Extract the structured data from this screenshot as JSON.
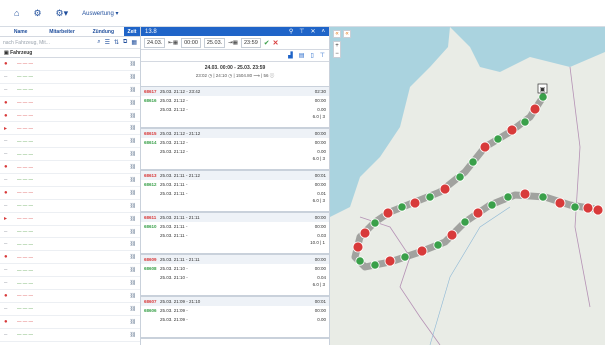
{
  "topbar": {
    "breadcrumb": "Auswertung ▾"
  },
  "left": {
    "tabs": [
      "Name",
      "Mitarbeiter",
      "Zündung",
      "Zeit"
    ],
    "filter_placeholder": "nach Fahrzeug, Mit...",
    "header": "Fahrzeug",
    "vehicles": [
      {
        "dot": "red",
        "status": "●",
        "name": "— — —"
      },
      {
        "dot": "gray",
        "status": "–",
        "name": "— — —"
      },
      {
        "dot": "gray",
        "status": "–",
        "name": "— — —"
      },
      {
        "dot": "red",
        "status": "●",
        "name": "— — —"
      },
      {
        "dot": "red",
        "status": "●",
        "name": "— — —"
      },
      {
        "dot": "red",
        "status": "▸",
        "name": "— — —"
      },
      {
        "dot": "gray",
        "status": "–",
        "name": "— — —"
      },
      {
        "dot": "gray",
        "status": "–",
        "name": "— — —"
      },
      {
        "dot": "red",
        "status": "●",
        "name": "— — —"
      },
      {
        "dot": "gray",
        "status": "–",
        "name": "— — —"
      },
      {
        "dot": "red",
        "status": "●",
        "name": "— — —"
      },
      {
        "dot": "gray",
        "status": "–",
        "name": "— — —"
      },
      {
        "dot": "red",
        "status": "▸",
        "name": "— — —"
      },
      {
        "dot": "gray",
        "status": "–",
        "name": "— — —"
      },
      {
        "dot": "gray",
        "status": "–",
        "name": "— — —"
      },
      {
        "dot": "red",
        "status": "●",
        "name": "— — —"
      },
      {
        "dot": "gray",
        "status": "–",
        "name": "— — —"
      },
      {
        "dot": "gray",
        "status": "–",
        "name": "— — —"
      },
      {
        "dot": "red",
        "status": "●",
        "name": "— — —"
      },
      {
        "dot": "gray",
        "status": "–",
        "name": "— — —"
      },
      {
        "dot": "red",
        "status": "●",
        "name": "— — —"
      },
      {
        "dot": "gray",
        "status": "–",
        "name": "— — —"
      }
    ]
  },
  "mid": {
    "title": "13.8",
    "date_from": "24.03.",
    "time_from": "00:00",
    "date_to": "25.03.",
    "time_to": "23:59",
    "summary_range": "24.03. 00:00 - 25.03. 23:59",
    "summary_stats": "23:02 ◷ | 24:10 ◷ | 1504.80 ⟶ | 56 ⓘ",
    "trips": [
      {
        "id": "68617",
        "line1": "25.03. 21:12 - 23:42",
        "v1": "02:30",
        "id2": "68616",
        "line2": "25.03. 21:12 - ",
        "v2": "00:00",
        "line3": "25.03. 21:12 - ",
        "v3": "0.00",
        "foot": "6.0 | 3"
      },
      {
        "id": "68615",
        "line1": "25.03. 21:12 - 21:12",
        "v1": "00:00",
        "id2": "68614",
        "line2": "25.03. 21:12 - ",
        "v2": "00:00",
        "line3": "25.03. 21:12 - ",
        "v3": "0.00",
        "foot": "6.0 | 3"
      },
      {
        "id": "68613",
        "line1": "25.03. 21:11 - 21:12",
        "v1": "00:01",
        "id2": "68612",
        "line2": "25.03. 21:11 - ",
        "v2": "00:00",
        "line3": "25.03. 21:11 - ",
        "v3": "0.01",
        "foot": "6.0 | 3"
      },
      {
        "id": "68611",
        "line1": "25.03. 21:11 - 21:11",
        "v1": "00:00",
        "id2": "68610",
        "line2": "25.03. 21:11 - ",
        "v2": "00:00",
        "line3": "25.03. 21:11 - ",
        "v3": "0.03",
        "foot": "10.0 | 1"
      },
      {
        "id": "68609",
        "line1": "25.03. 21:11 - 21:11",
        "v1": "00:00",
        "id2": "68608",
        "line2": "25.03. 21:10 - ",
        "v2": "00:00",
        "line3": "25.03. 21:10 - ",
        "v3": "0.04",
        "foot": "6.0 | 3"
      },
      {
        "id": "68607",
        "line1": "25.03. 21:09 - 21:10",
        "v1": "00:01",
        "id2": "68606",
        "line2": "25.03. 21:09 - ",
        "v2": "00:00",
        "line3": "25.03. 21:09 - ",
        "v3": "0.00",
        "foot": ""
      }
    ]
  },
  "colors": {
    "accent": "#1f64c8",
    "stop": "#d83a3a",
    "start": "#3aa04a"
  }
}
